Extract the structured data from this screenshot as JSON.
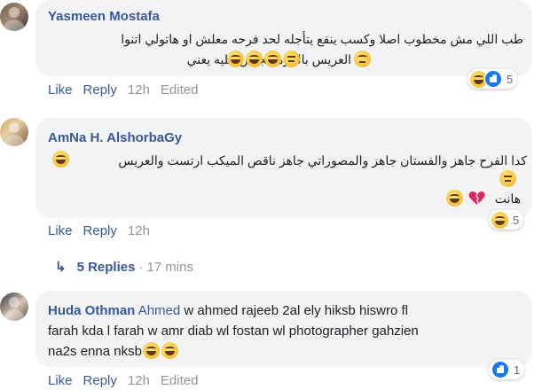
{
  "comments": [
    {
      "author": "Yasmeen Mostafa",
      "lines": [
        "طب اللي مش مخطوب اصلا وكسب ينفع يتأجله لحد فرحه معلش او هاتولي اتنوا",
        "العريس بالمره مجتش عليه يعني"
      ],
      "reaction_count": "5",
      "actions": {
        "like": "Like",
        "reply": "Reply",
        "time": "12h",
        "edited": "Edited"
      }
    },
    {
      "author": "AmNa H. AlshorbaGy",
      "lines": [
        "كدا الفرح جاهز والفستان جاهز والمصوراتي جاهز ناقص الميكب ارتست والعريس",
        "هانت"
      ],
      "reaction_count": "5",
      "actions": {
        "like": "Like",
        "reply": "Reply",
        "time": "12h"
      }
    },
    {
      "author": "Huda Othman",
      "mention": "Ahmed",
      "lines": [
        " w ahmed rajeeb 2al ely hiksb hiswro fl",
        "farah kda l farah w amr diab wl fostan wl photographer gahzien",
        "na2s enna nksb"
      ],
      "reaction_count": "1",
      "actions": {
        "like": "Like",
        "reply": "Reply",
        "time": "12h",
        "edited": "Edited"
      }
    }
  ],
  "replies_link": {
    "arrow": "↳",
    "label": "5 Replies",
    "separator": "·",
    "time": "17 mins"
  },
  "icons": [
    "laugh-emoji",
    "thinking-emoji",
    "eye-roll-emoji",
    "broken-heart-emoji",
    "like-reaction-icon",
    "haha-reaction-icon"
  ],
  "colors": {
    "link": "#385898",
    "bubble": "#f2f3f5",
    "meta": "#90949c",
    "like_blue": "#1877f2"
  }
}
